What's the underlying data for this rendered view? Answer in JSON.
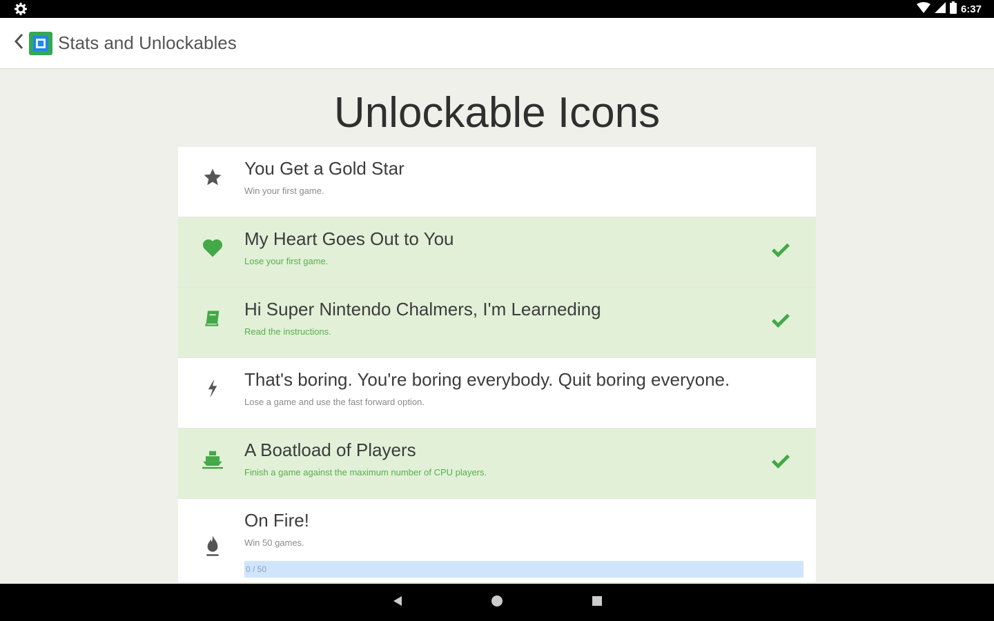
{
  "status_bar": {
    "time": "6:37",
    "icons": [
      "settings-icon",
      "wifi-icon",
      "signal-icon",
      "battery-icon"
    ]
  },
  "app_bar": {
    "title": "Stats and Unlockables",
    "icons": [
      "back-arrow-icon",
      "app-logo-icon"
    ]
  },
  "heading": "Unlockable Icons",
  "colors": {
    "unlocked_row": "#e2f0d8",
    "accent_green": "#34a853",
    "progress_fill": "#cfe5fb"
  },
  "achievements": [
    {
      "icon": "star-icon",
      "title": "You Get a Gold Star",
      "description": "Win your first game.",
      "unlocked": false
    },
    {
      "icon": "heart-icon",
      "title": "My Heart Goes Out to You",
      "description": "Lose your first game.",
      "unlocked": true
    },
    {
      "icon": "book-icon",
      "title": "Hi Super Nintendo Chalmers, I'm Learneding",
      "description": "Read the instructions.",
      "unlocked": true
    },
    {
      "icon": "lightning-icon",
      "title": "That's boring. You're boring everybody. Quit boring everyone.",
      "description": "Lose a game and use the fast forward option.",
      "unlocked": false
    },
    {
      "icon": "ship-icon",
      "title": "A Boatload of Players",
      "description": "Finish a game against the maximum number of CPU players.",
      "unlocked": true
    },
    {
      "icon": "fire-icon",
      "title": "On Fire!",
      "description": "Win 50 games.",
      "unlocked": false,
      "progress": {
        "label": "0 / 50",
        "value": 0,
        "max": 50
      }
    }
  ],
  "nav_bar": {
    "buttons": [
      "back-triangle-icon",
      "home-circle-icon",
      "recents-square-icon"
    ]
  }
}
